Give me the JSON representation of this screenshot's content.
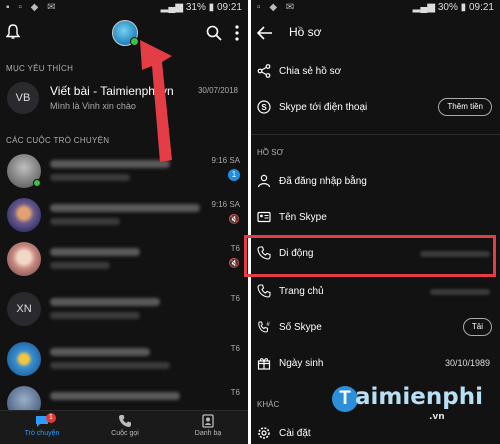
{
  "left": {
    "status": {
      "battery": "31%",
      "time": "09:21"
    },
    "sections": {
      "favorites": "MỤC YÊU THÍCH",
      "conversations": "CÁC CUỘC TRÒ CHUYỆN"
    },
    "favorite": {
      "initials": "VB",
      "title": "Viết bài - Taimienphi.vn",
      "subtitle": "Mình là Vinh xin chào",
      "date": "30/07/2018"
    },
    "conversations": [
      {
        "time": "9:16 SA",
        "badge": "1"
      },
      {
        "time": "9:16 SA"
      },
      {
        "time": "T6"
      },
      {
        "initials": "XN",
        "time": "T6"
      },
      {
        "time": "T6"
      },
      {
        "time": "T6"
      }
    ],
    "nav": {
      "chats": "Trò chuyện",
      "chats_badge": "1",
      "calls": "Cuộc gọi",
      "contacts": "Danh bạ"
    }
  },
  "right": {
    "status": {
      "battery": "30%",
      "time": "09:21"
    },
    "title": "Hồ sơ",
    "share": "Chia sẻ hồ sơ",
    "skype_phone": "Skype tới điện thoại",
    "add_credit": "Thêm tiền",
    "section_profile": "HỒ SƠ",
    "signed_in": "Đã đăng nhập bằng",
    "skype_name": "Tên Skype",
    "mobile": "Di động",
    "home": "Trang chủ",
    "skype_number": "Số Skype",
    "get_label": "Tải",
    "birthday": "Ngày sinh",
    "birthday_value": "30/10/1989",
    "section_other": "KHÁC",
    "settings": "Cài đặt"
  },
  "watermark": {
    "logo": "T",
    "text": "aimienphi",
    "sub": ".vn"
  },
  "colors": {
    "accent": "#2d9cff",
    "highlight": "#e53d45",
    "online": "#3bc14a"
  }
}
